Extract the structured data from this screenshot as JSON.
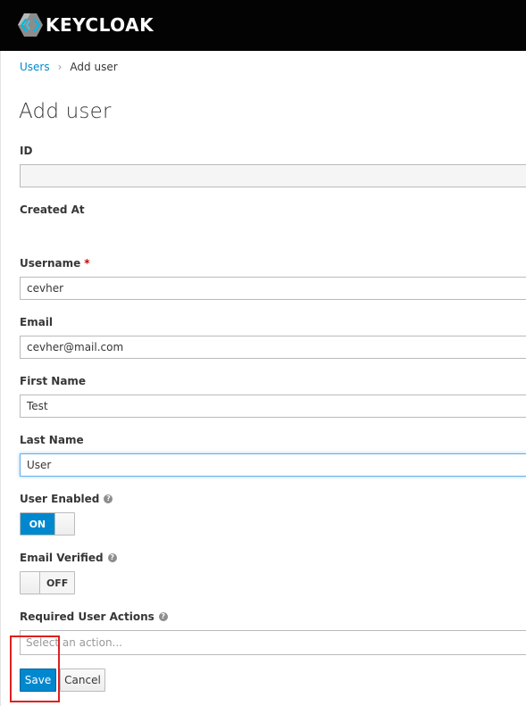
{
  "header": {
    "brand": "KEYCLOAK"
  },
  "breadcrumb": {
    "parent": "Users",
    "separator": "›",
    "current": "Add user"
  },
  "page": {
    "title": "Add user"
  },
  "form": {
    "id": {
      "label": "ID",
      "value": ""
    },
    "created_at": {
      "label": "Created At",
      "value": ""
    },
    "username": {
      "label": "Username",
      "required_mark": "*",
      "value": "cevher"
    },
    "email": {
      "label": "Email",
      "value": "cevher@mail.com"
    },
    "first_name": {
      "label": "First Name",
      "value": "Test"
    },
    "last_name": {
      "label": "Last Name",
      "value": "User"
    },
    "user_enabled": {
      "label": "User Enabled",
      "help": "?",
      "state": "ON"
    },
    "email_verified": {
      "label": "Email Verified",
      "help": "?",
      "state": "OFF"
    },
    "required_actions": {
      "label": "Required User Actions",
      "help": "?",
      "placeholder": "Select an action..."
    }
  },
  "actions": {
    "save": "Save",
    "cancel": "Cancel"
  },
  "colors": {
    "accent": "#0088ce",
    "header_bg": "#030303",
    "highlight": "#e0201e"
  }
}
